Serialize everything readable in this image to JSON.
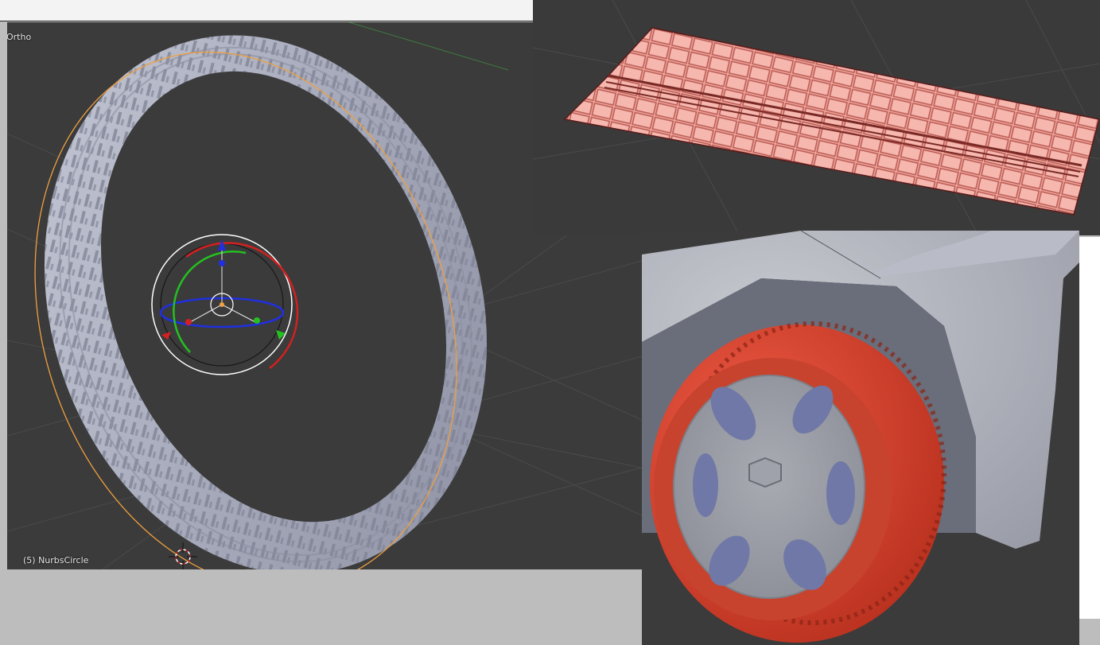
{
  "viewport_main": {
    "view_label": "Ortho",
    "object_label": "(5) NurbsCircle"
  },
  "colors": {
    "viewport_bg": "#3b3b3b",
    "tire_grey": "#a9adbd",
    "tire_red": "#d9442f",
    "tread_pink": "#f0a79e",
    "selection_orange": "#f0a040",
    "axis_x": "#d32020",
    "axis_y": "#25c020",
    "axis_z": "#2030e0"
  },
  "icons": {
    "manipulator": "rotate-gizmo-icon",
    "cursor": "3d-cursor-icon"
  }
}
